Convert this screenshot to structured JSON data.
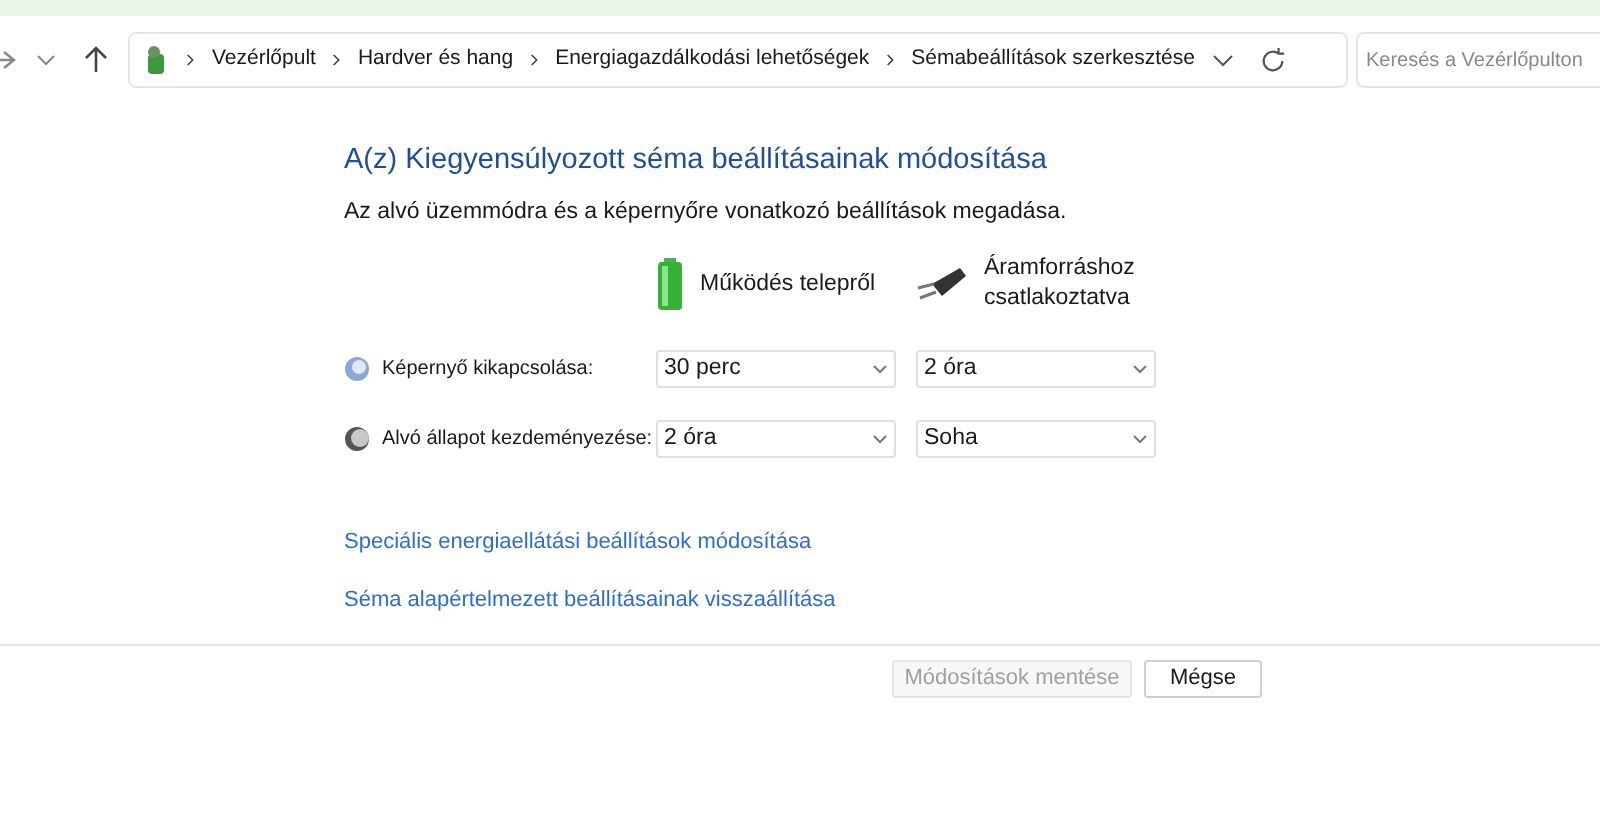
{
  "breadcrumb": [
    "Vezérlőpult",
    "Hardver és hang",
    "Energiagazdálkodási lehetőségek",
    "Sémabeállítások szerkesztése"
  ],
  "search": {
    "placeholder": "Keresés a Vezérlőpulton"
  },
  "title": "A(z) Kiegyensúlyozott séma beállításainak módosítása",
  "subtitle": "Az alvó üzemmódra és a képernyőre vonatkozó beállítások megadása.",
  "columns": [
    {
      "kind": "battery",
      "label": "Működés telepről"
    },
    {
      "kind": "plug",
      "label": "Áramforráshoz csatlakoztatva"
    }
  ],
  "settings": [
    {
      "kind": "display",
      "label": "Képernyő kikapcsolása:",
      "values": [
        "30 perc",
        "2 óra"
      ]
    },
    {
      "kind": "sleep",
      "label": "Alvó állapot kezdeményezése:",
      "values": [
        "2 óra",
        "Soha"
      ]
    }
  ],
  "links": [
    "Speciális energiaellátási beállítások módosítása",
    "Séma alapértelmezett beállításainak visszaállítása"
  ],
  "buttons": [
    {
      "label": "Módosítások mentése",
      "disabled": true
    },
    {
      "label": "Mégse",
      "disabled": false
    }
  ]
}
